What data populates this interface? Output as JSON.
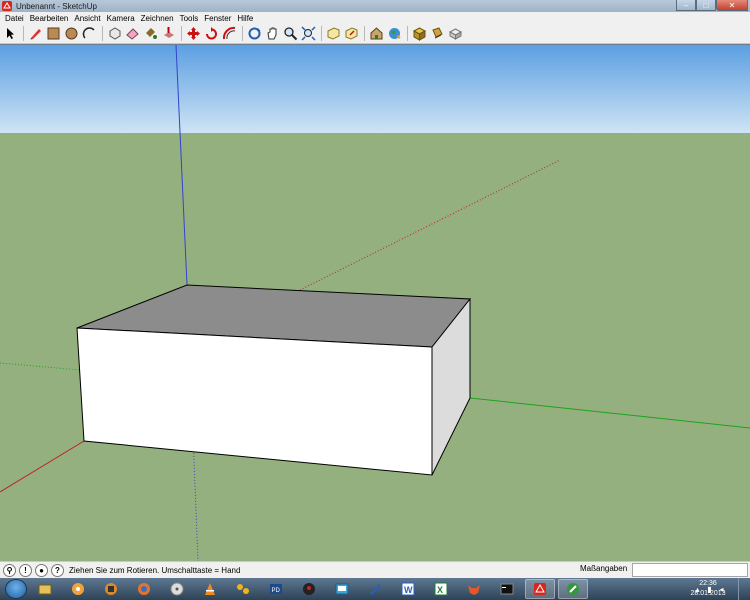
{
  "window": {
    "title": "Unbenannt - SketchUp",
    "controls": {
      "minimize": "–",
      "maximize": "□",
      "close": "✕"
    }
  },
  "menu": [
    "Datei",
    "Bearbeiten",
    "Ansicht",
    "Kamera",
    "Zeichnen",
    "Tools",
    "Fenster",
    "Hilfe"
  ],
  "toolbar": {
    "groups": [
      [
        "select-tool-icon",
        "pencil-tool-icon",
        "rectangle-tool-icon",
        "circle-tool-icon",
        "arc-tool-icon"
      ],
      [
        "make-component-icon",
        "eraser-tool-icon",
        "paint-bucket-icon"
      ],
      [
        "push-pull-icon",
        "move-tool-icon",
        "rotate-tool-icon",
        "offset-tool-icon"
      ],
      [
        "orbit-tool-icon",
        "pan-tool-icon",
        "zoom-tool-icon",
        "zoom-extents-icon"
      ],
      [
        "get-models-icon",
        "share-model-icon"
      ],
      [
        "warehouse-icon",
        "earth-icon"
      ],
      [
        "component-icon",
        "material-icon",
        "style-icon"
      ]
    ]
  },
  "status": {
    "text": "Ziehen Sie zum Rotieren.  Umschalttaste = Hand",
    "measure_label": "Maßangaben",
    "measure_value": ""
  },
  "taskbar": {
    "apps": [
      "file-explorer-icon",
      "burning-icon",
      "movie-icon",
      "firefox-icon",
      "dvd-icon",
      "vlc-icon",
      "network-icon",
      "pdf-icon",
      "media-icon",
      "window-icon",
      "sketchup-pen-icon",
      "word-icon",
      "excel-icon",
      "fox-icon",
      "console-icon",
      "sketchup-icon",
      "layout-icon"
    ],
    "active_apps": [
      15,
      16
    ],
    "clock_time": "22:36",
    "clock_date": "28.01.2013"
  },
  "colors": {
    "sky_top": "#5b9fe3",
    "sky_bottom": "#cfe4f4",
    "ground": "#95b07f",
    "box_front": "#ffffff",
    "box_top": "#8c8c8c",
    "box_side": "#dcdcdc",
    "axis_blue": "#3344cc",
    "axis_green": "#1ca31c",
    "axis_red": "#c02020"
  }
}
